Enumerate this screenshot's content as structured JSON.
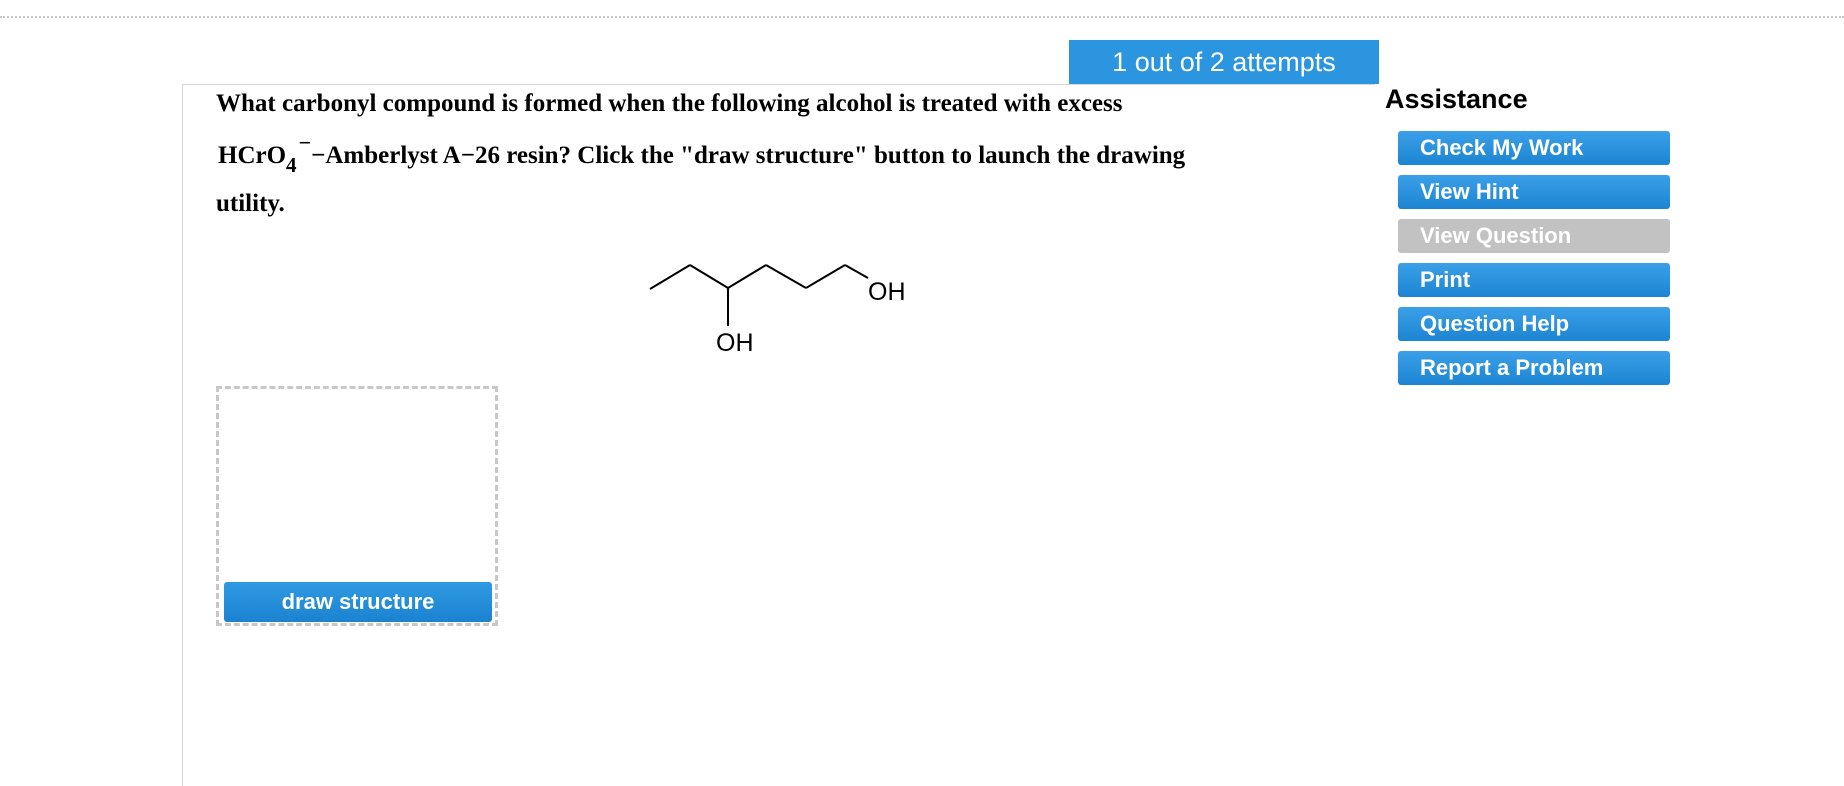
{
  "attempts_label": "1 out of 2 attempts",
  "question": {
    "line1": "What carbonyl compound is formed when the following alcohol is treated with excess",
    "line2_prefix": "HCrO",
    "line2_subscript": "4",
    "line2_superscript": "−",
    "line2_suffix": "−Amberlyst A−26 resin? Click the \"draw structure\" button to launch the drawing",
    "line3": "utility."
  },
  "molecule": {
    "label_oh_right": "OH",
    "label_oh_bottom": "OH"
  },
  "draw_structure_label": "draw structure",
  "assistance": {
    "title": "Assistance",
    "buttons": [
      {
        "label": "Check My Work",
        "enabled": true
      },
      {
        "label": "View Hint",
        "enabled": true
      },
      {
        "label": "View Question",
        "enabled": false
      },
      {
        "label": "Print",
        "enabled": true
      },
      {
        "label": "Question Help",
        "enabled": true
      },
      {
        "label": "Report a Problem",
        "enabled": true
      }
    ]
  },
  "colors": {
    "accent": "#2b95e0",
    "disabled": "#c2c2c2",
    "dashed_border": "#c8c8c8"
  }
}
